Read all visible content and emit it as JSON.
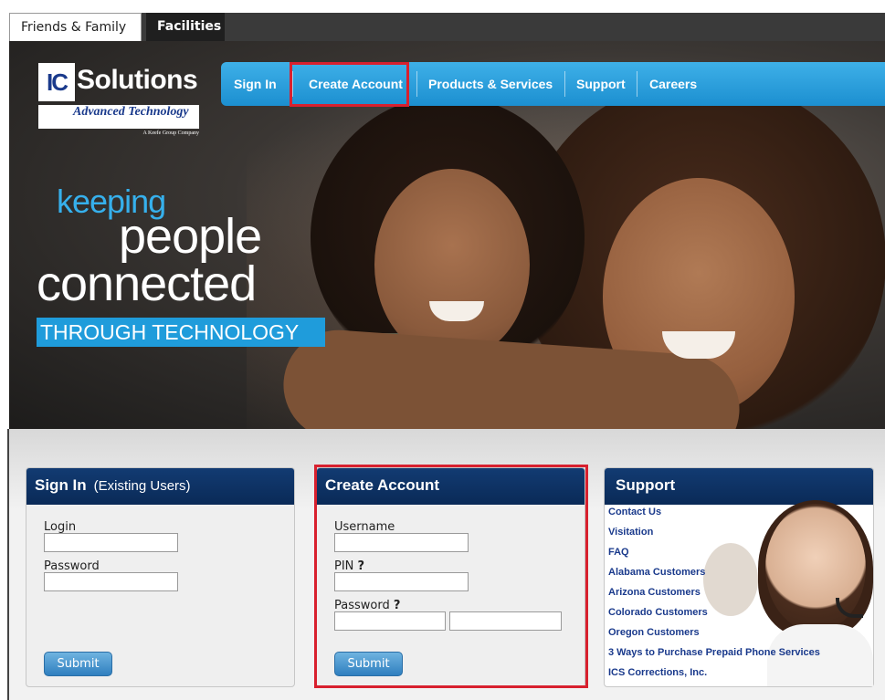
{
  "tabs": [
    {
      "label": "Friends & Family",
      "active": true
    },
    {
      "label": "Facilities",
      "active": false
    }
  ],
  "logo": {
    "ic": "IC",
    "name": "Solutions",
    "tagline": "Advanced Technology",
    "parent": "A Keefe Group Company"
  },
  "nav": {
    "items": [
      {
        "label": "Sign In"
      },
      {
        "label": "Create Account",
        "highlighted": true
      },
      {
        "label": "Products & Services"
      },
      {
        "label": "Support"
      },
      {
        "label": "Careers"
      }
    ],
    "color": "#2aa2e0",
    "highlight_color": "#d8202e"
  },
  "hero": {
    "line1": "keeping",
    "line2": "people",
    "line3": "connected",
    "line4": "THROUGH TECHNOLOGY"
  },
  "signin": {
    "title": "Sign In",
    "subtitle": "(Existing Users)",
    "login_label": "Login",
    "login_value": "",
    "password_label": "Password",
    "password_value": "",
    "submit_label": "Submit"
  },
  "create": {
    "title": "Create Account",
    "username_label": "Username",
    "pin_label": "PIN",
    "pin_help": "?",
    "password_label": "Password",
    "password_help": "?",
    "submit_label": "Submit"
  },
  "support": {
    "title": "Support",
    "links": [
      "Contact Us",
      "Visitation",
      "FAQ",
      "Alabama Customers",
      "Arizona Customers",
      "Colorado Customers",
      "Oregon Customers",
      "3 Ways to Purchase Prepaid Phone Services",
      "ICS Corrections, Inc."
    ]
  },
  "colors": {
    "panel_header": "#0f3468",
    "link": "#1a3a8c",
    "button": "#4a97d1"
  }
}
